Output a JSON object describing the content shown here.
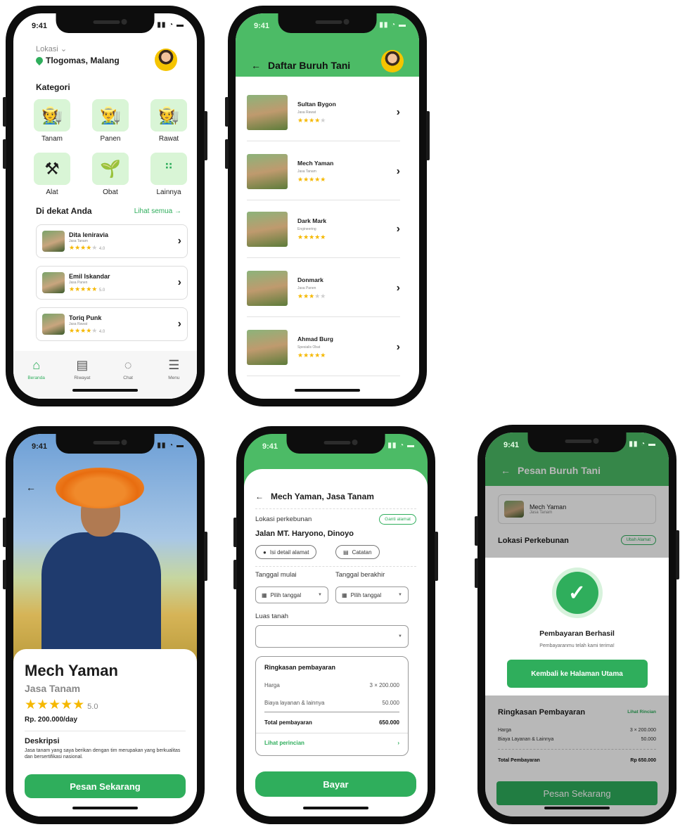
{
  "status_time": "9:41",
  "home": {
    "location_label": "Lokasi",
    "location": "Tlogomas, Malang",
    "categories_title": "Kategori",
    "categories": [
      {
        "label": "Tanam",
        "icon": "planting-icon"
      },
      {
        "label": "Panen",
        "icon": "harvest-icon"
      },
      {
        "label": "Rawat",
        "icon": "farmer-icon"
      },
      {
        "label": "Alat",
        "icon": "tools-icon"
      },
      {
        "label": "Obat",
        "icon": "medicine-icon"
      },
      {
        "label": "Lainnya",
        "icon": "more-icon"
      }
    ],
    "nearby_title": "Di dekat Anda",
    "see_all": "Lihat semua",
    "nearby": [
      {
        "name": "Dita leniravia",
        "job": "Jasa Tanam",
        "rating": "4.0"
      },
      {
        "name": "Emil Iskandar",
        "job": "Jasa Panen",
        "rating": "5.0"
      },
      {
        "name": "Toriq Punk",
        "job": "Jasa Rawat",
        "rating": "4.0"
      }
    ],
    "nav": [
      {
        "label": "Beranda",
        "icon": "home-icon"
      },
      {
        "label": "Riwayat",
        "icon": "history-icon"
      },
      {
        "label": "Chat",
        "icon": "chat-icon"
      },
      {
        "label": "Menu",
        "icon": "menu-icon"
      }
    ]
  },
  "list": {
    "title": "Daftar Buruh Tani",
    "workers": [
      {
        "name": "Sultan Bygon",
        "job": "Jasa Rawat"
      },
      {
        "name": "Mech Yaman",
        "job": "Jasa Tanam"
      },
      {
        "name": "Dark Mark",
        "job": "Engineering"
      },
      {
        "name": "Donmark",
        "job": "Jasa Panen"
      },
      {
        "name": "Ahmad Burg",
        "job": "Spesialis Obat"
      }
    ]
  },
  "detail": {
    "name": "Mech Yaman",
    "job": "Jasa Tanam",
    "stars": "★★★★★",
    "rating": "5.0",
    "price": "Rp. 200.000/day",
    "desc_title": "Deskripsi",
    "desc": "Jasa tanam yang saya berikan dengan tim merupakan yang berkualitas dan bersertifikasi  nasional.",
    "cta": "Pesan Sekarang"
  },
  "order": {
    "title": "Mech Yaman, Jasa Tanam",
    "loc_label": "Lokasi perkebunan",
    "change_loc": "Ganti alamat",
    "address": "Jalan MT. Haryono, Dinoyo",
    "detail_chip": "Isi detail alamat",
    "note_chip": "Catatan",
    "start_label": "Tanggal mulai",
    "end_label": "Tanggal berakhir",
    "pick_date": "Pilih tanggal",
    "area_label": "Luas tanah",
    "summary_title": "Ringkasan pembayaran",
    "price_label": "Harga",
    "price_value": "3 × 200.000",
    "fee_label": "Biaya layanan & lainnya",
    "fee_value": "50.000",
    "total_label": "Total pembayaran",
    "total_value": "650.000",
    "details_link": "Lihat perincian",
    "pay": "Bayar"
  },
  "success": {
    "header": "Pesan Buruh Tani",
    "worker": "Mech Yaman",
    "worker_job": "Jasa Tanam",
    "loc_title": "Lokasi Perkebunan",
    "change_loc": "Ubah Alamat",
    "modal_title": "Pembayaran Berhasil",
    "modal_sub": "Pembayaranmu telah kami terima!",
    "modal_btn": "Kembali ke Halaman Utama",
    "summary_title": "Ringkasan Pembayaran",
    "summary_link": "Lihat Rincian",
    "price_label": "Harga",
    "price_value": "3 × 200.000",
    "fee_label": "Biaya Layanan & Lainnya",
    "fee_value": "50.000",
    "total_label": "Total Pembayaran",
    "total_value": "Rp 650.000",
    "cta": "Pesan Sekarang"
  }
}
